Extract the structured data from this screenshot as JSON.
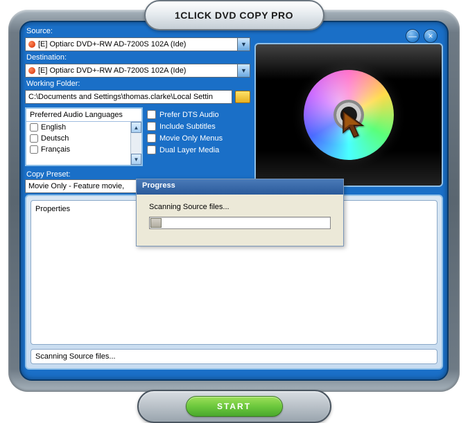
{
  "title": "1CLICK DVD COPY PRO",
  "window_controls": {
    "minimize": "—",
    "close": "×"
  },
  "source": {
    "label": "Source:",
    "value": "[E] Optiarc DVD+-RW AD-7200S 102A (Ide)"
  },
  "destination": {
    "label": "Destination:",
    "value": "[E] Optiarc DVD+-RW AD-7200S 102A (Ide)"
  },
  "working_folder": {
    "label": "Working Folder:",
    "value": "C:\\Documents and Settings\\thomas.clarke\\Local Settin"
  },
  "languages": {
    "header": "Preferred Audio Languages",
    "items": [
      "English",
      "Deutsch",
      "Français"
    ]
  },
  "options": {
    "prefer_dts": "Prefer DTS Audio",
    "include_subs": "Include Subtitles",
    "movie_only_menus": "Movie Only Menus",
    "dual_layer": "Dual Layer Media"
  },
  "copy_preset": {
    "label": "Copy Preset:",
    "value": "Movie Only - Feature movie,"
  },
  "properties": {
    "header": "Properties"
  },
  "status": "Scanning Source files...",
  "progress": {
    "title": "Progress",
    "message": "Scanning Source files...",
    "percent": 6
  },
  "start_button": "START"
}
